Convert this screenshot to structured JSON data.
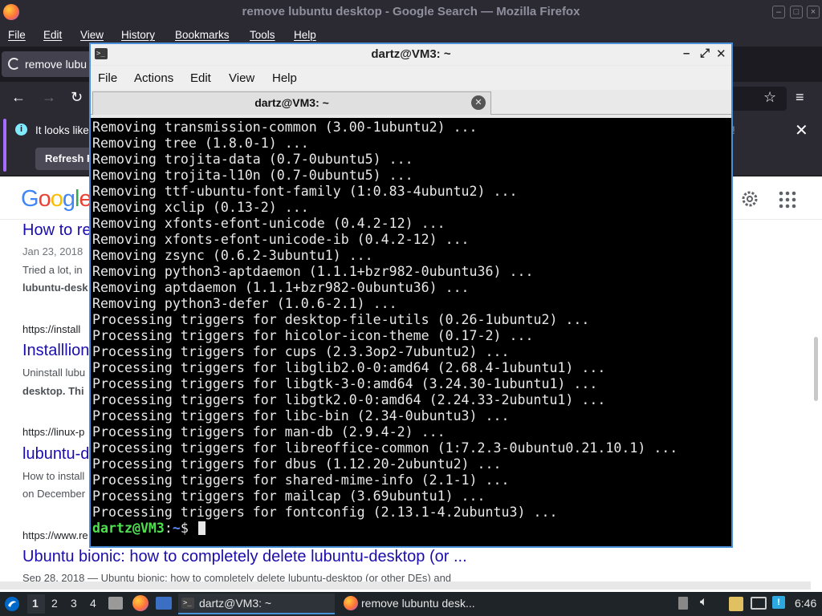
{
  "firefox": {
    "window_title": "remove lubuntu desktop - Google Search — Mozilla Firefox",
    "menu": [
      "File",
      "Edit",
      "View",
      "History",
      "Bookmarks",
      "Tools",
      "Help"
    ],
    "tab_label": "remove lubu",
    "notice_text": "It looks like",
    "notice_button": "Refresh F",
    "notice_trailing": "!"
  },
  "google": {
    "logo": "Google",
    "results": [
      {
        "title": "How to re",
        "date": "Jan 23, 2018",
        "snippet1": "Tried a lot, in",
        "snippet2": "lubuntu-desk"
      },
      {
        "url": "https://install",
        "title": "Installlion",
        "snippet1": "Uninstall lubu",
        "snippet2": "desktop. Thi"
      },
      {
        "url": "https://linux-p",
        "title": "lubuntu-d",
        "snippet1": "How to install",
        "snippet2": "on December"
      },
      {
        "url": "https://www.re",
        "title": "Ubuntu bionic: how to completely delete lubuntu-desktop (or ...",
        "snippet1": "Sep 28, 2018 — Ubuntu bionic: how to completely delete lubuntu-desktop (or other DEs) and"
      }
    ]
  },
  "terminal": {
    "window_title": "dartz@VM3: ~",
    "menu": [
      "File",
      "Actions",
      "Edit",
      "View",
      "Help"
    ],
    "tab_label": "dartz@VM3: ~",
    "lines": [
      "Removing transmission-common (3.00-1ubuntu2) ...",
      "Removing tree (1.8.0-1) ...",
      "Removing trojita-data (0.7-0ubuntu5) ...",
      "Removing trojita-l10n (0.7-0ubuntu5) ...",
      "Removing ttf-ubuntu-font-family (1:0.83-4ubuntu2) ...",
      "Removing xclip (0.13-2) ...",
      "Removing xfonts-efont-unicode (0.4.2-12) ...",
      "Removing xfonts-efont-unicode-ib (0.4.2-12) ...",
      "Removing zsync (0.6.2-3ubuntu1) ...",
      "Removing python3-aptdaemon (1.1.1+bzr982-0ubuntu36) ...",
      "Removing aptdaemon (1.1.1+bzr982-0ubuntu36) ...",
      "Removing python3-defer (1.0.6-2.1) ...",
      "Processing triggers for desktop-file-utils (0.26-1ubuntu2) ...",
      "Processing triggers for hicolor-icon-theme (0.17-2) ...",
      "Processing triggers for cups (2.3.3op2-7ubuntu2) ...",
      "Processing triggers for libglib2.0-0:amd64 (2.68.4-1ubuntu1) ...",
      "Processing triggers for libgtk-3-0:amd64 (3.24.30-1ubuntu1) ...",
      "Processing triggers for libgtk2.0-0:amd64 (2.24.33-2ubuntu1) ...",
      "Processing triggers for libc-bin (2.34-0ubuntu3) ...",
      "Processing triggers for man-db (2.9.4-2) ...",
      "Processing triggers for libreoffice-common (1:7.2.3-0ubuntu0.21.10.1) ...",
      "Processing triggers for dbus (1.12.20-2ubuntu2) ...",
      "Processing triggers for shared-mime-info (2.1-1) ...",
      "Processing triggers for mailcap (3.69ubuntu1) ...",
      "Processing triggers for fontconfig (2.13.1-4.2ubuntu3) ..."
    ],
    "prompt_user": "dartz@VM3",
    "prompt_sep": ":",
    "prompt_path": "~",
    "prompt_symbol": "$"
  },
  "taskbar": {
    "workspaces": [
      "1",
      "2",
      "3",
      "4"
    ],
    "task_terminal": "dartz@VM3: ~",
    "task_firefox": "remove lubuntu desk...",
    "clock": "6:46"
  }
}
